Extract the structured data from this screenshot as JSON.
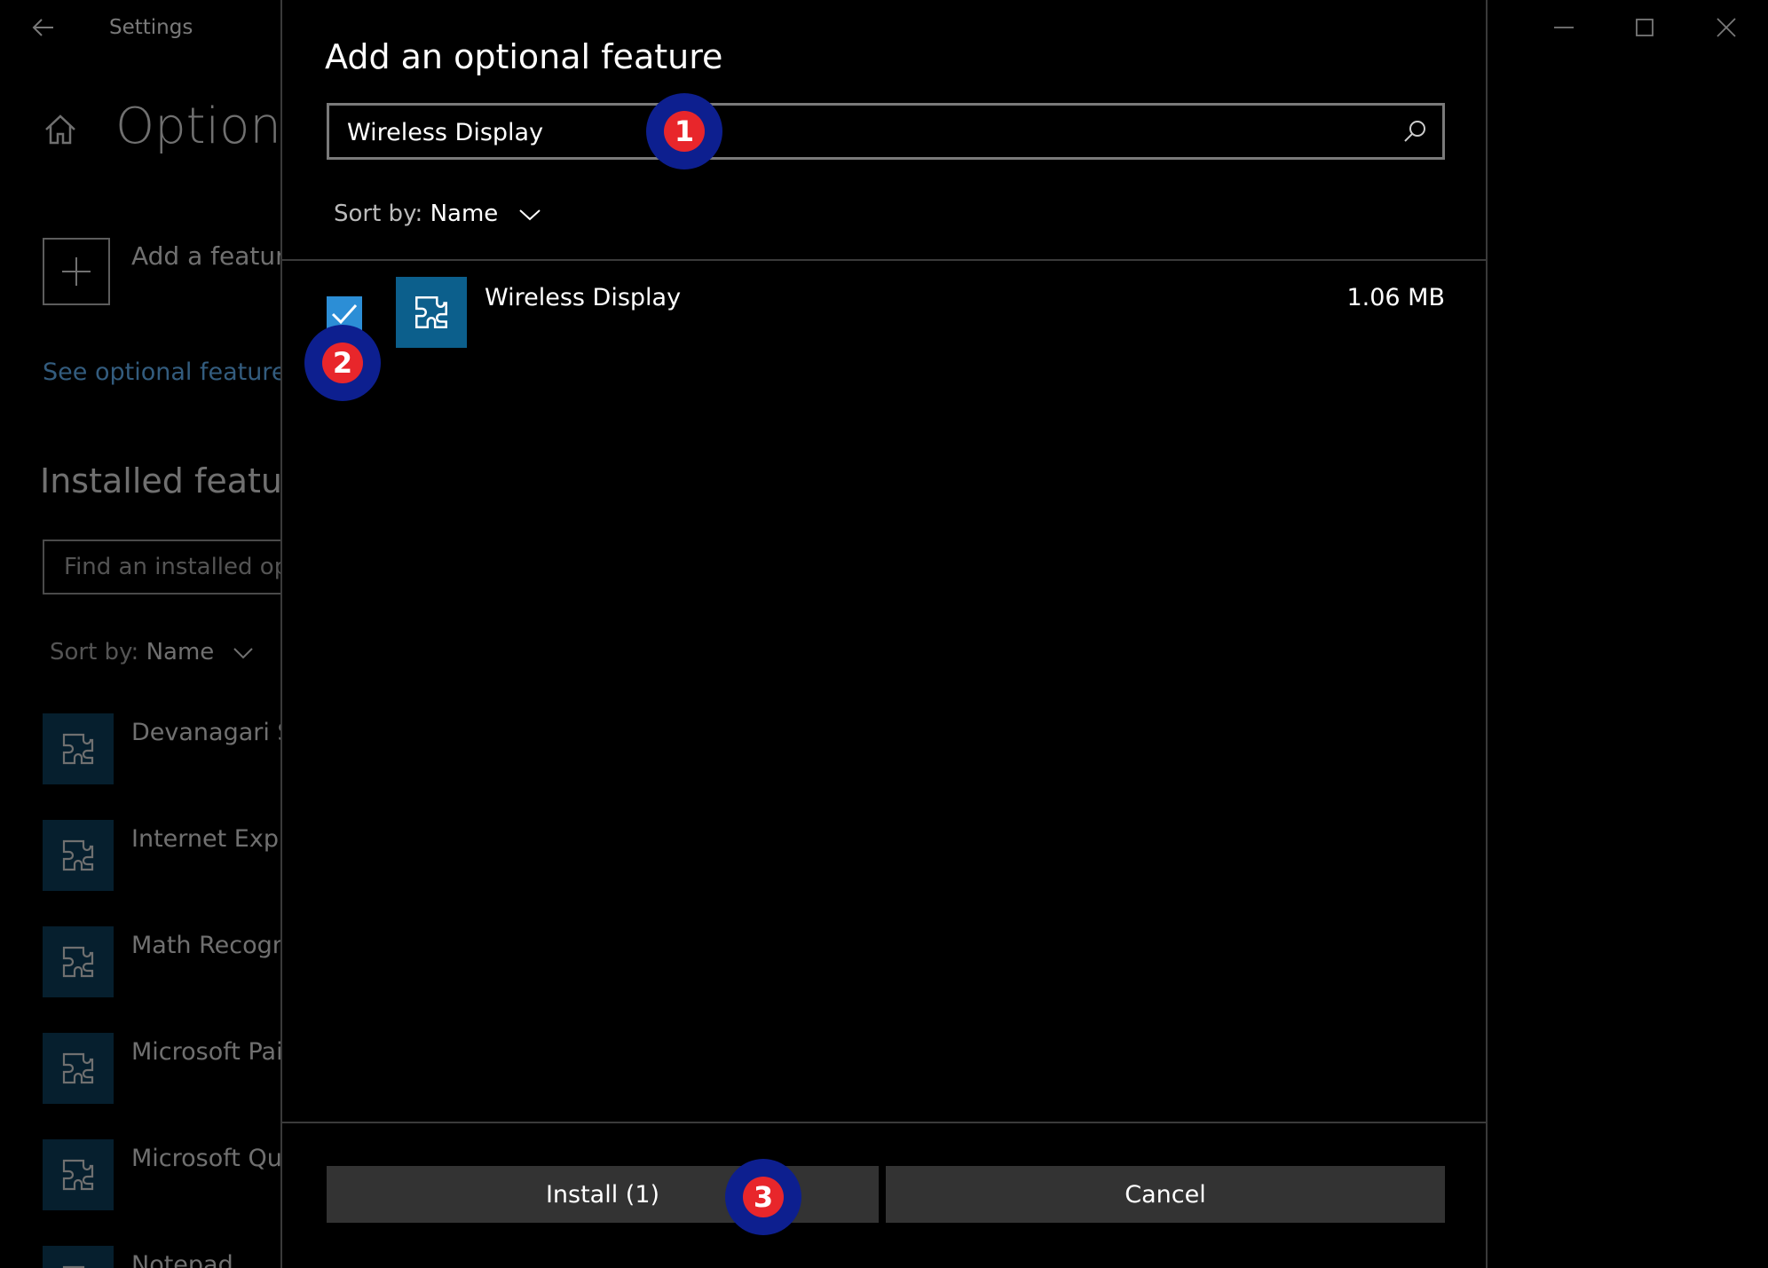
{
  "background": {
    "window_title": "Settings",
    "page_title": "Optiona",
    "add_feature_label": "Add a feature",
    "history_link": "See optional feature h",
    "installed_heading": "Installed feature",
    "search_placeholder": "Find an installed opt",
    "sort_label": "Sort by:",
    "sort_value": "Name",
    "installed_items": [
      "Devanagari Su",
      "Internet Explo",
      "Math Recogni",
      "Microsoft Pair",
      "Microsoft Qui",
      "Notepad"
    ]
  },
  "dialog": {
    "title": "Add an optional feature",
    "search": {
      "value": "Wireless Display"
    },
    "sort_label": "Sort by:",
    "sort_value": "Name",
    "results": [
      {
        "name": "Wireless Display",
        "size": "1.06 MB",
        "checked": true
      }
    ],
    "install_label": "Install (1)",
    "cancel_label": "Cancel"
  },
  "badges": {
    "step1": "1",
    "step2": "2",
    "step3": "3"
  },
  "colors": {
    "accent_link": "#5ea8e6",
    "checkbox": "#2c8ed6",
    "feature_tile": "#0c5f8c",
    "badge_outer": "#0d1f8f",
    "badge_inner": "#e8262b"
  }
}
